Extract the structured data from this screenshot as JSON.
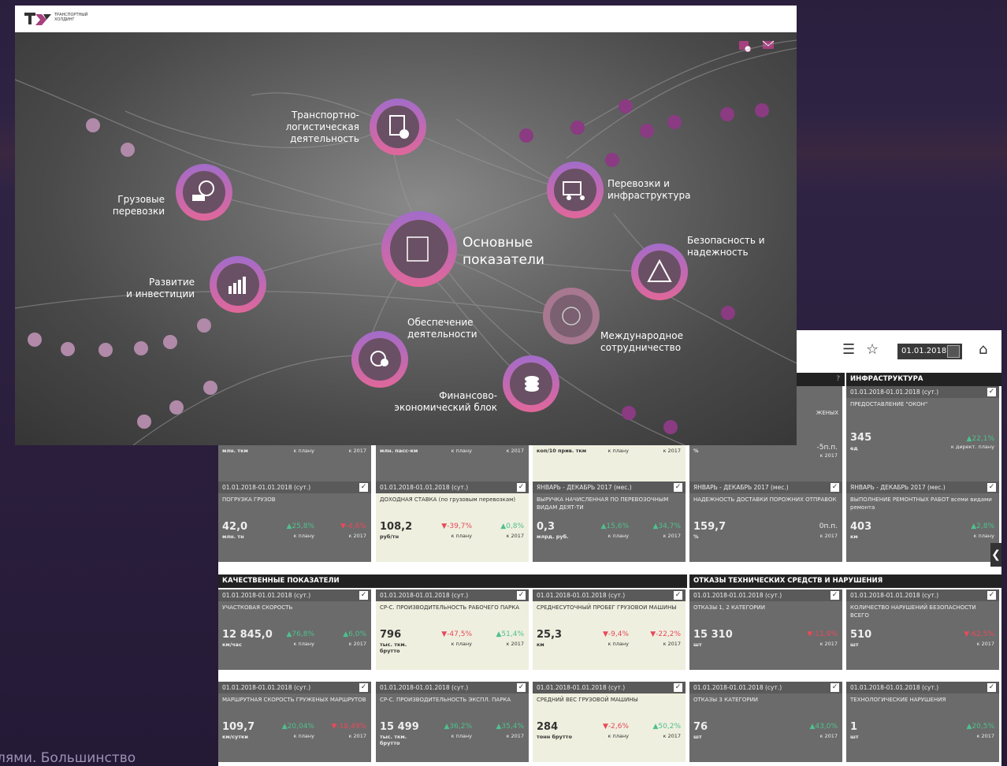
{
  "hero": {
    "logo_text": [
      "ТРАНСПОРТНЫЙ",
      "ХОЛДИНГ"
    ],
    "icons": [
      "calendar-icon",
      "mail-icon"
    ],
    "nodes": {
      "center": [
        "Основные",
        "показатели"
      ],
      "transport": [
        "Транспортно-логистическая",
        "деятельность"
      ],
      "cargo": [
        "Грузовые",
        "перевозки"
      ],
      "development": [
        "Развитие",
        "и инвестиции"
      ],
      "support": [
        "Обеспечение",
        "деятельности"
      ],
      "transport_infra": [
        "Перевозки и",
        "инфраструктура"
      ],
      "safety": [
        "Безопасность и",
        "надежность"
      ],
      "international": [
        "Международное",
        "сотрудничество"
      ],
      "finance": [
        "Финансово-",
        "экономический блок"
      ]
    }
  },
  "dashboard": {
    "date": "01.01.2018",
    "sections": {
      "infra": "ИНФРАСТРУКТУРА",
      "quality": "КАЧЕСТВЕННЫЕ ПОКАЗАТЕЛИ",
      "failures": "ОТКАЗЫ ТЕХНИЧЕСКИХ СРЕДСТВ И НАРУШЕНИЯ"
    },
    "top_row": {
      "c1": {
        "unit": "млн. ткм",
        "s1": "к плану",
        "s2": "к 2017"
      },
      "c2": {
        "unit": "млн. пасс-км",
        "s1": "к плану",
        "s2": "к 2017"
      },
      "c3": {
        "unit": "коп/10 прив. ткм",
        "s1": "к плану",
        "s2": "к 2017"
      },
      "c4": {
        "title_tail": "ЖЕНЫХ",
        "unit": "%",
        "d2": "-5п.п.",
        "s2": "к 2017"
      },
      "c5": {
        "period": "01.01.2018-01.01.2018 (сут.)",
        "title": "ПРЕДОСТАВЛЕНИЕ \"ОКОН\"",
        "value": "345",
        "unit": "ед",
        "d2": "▲22,1%",
        "s2": "к директ. плану"
      }
    },
    "row2": [
      {
        "period": "01.01.2018-01.01.2018 (сут.)",
        "title": "ПОГРУЗКА ГРУЗОВ",
        "value": "42,0",
        "unit": "млн. тн",
        "d1": "▲25,8%",
        "s1": "к плану",
        "d2": "▼-4,6%",
        "s2": "к 2017"
      },
      {
        "period": "01.01.2018-01.01.2018 (сут.)",
        "title": "ДОХОДНАЯ СТАВКА (по грузовым перевозкам)",
        "value": "108,2",
        "unit": "руб/тн",
        "d1": "▼-39,7%",
        "s1": "к плану",
        "d2": "▲0,8%",
        "s2": "к 2017"
      },
      {
        "period": "ЯНВАРЬ - ДЕКАБРЬ 2017 (мес.)",
        "title": "ВЫРУЧКА НАЧИСЛЕННАЯ ПО ПЕРЕВОЗОЧНЫМ ВИДАМ ДЕЯТ-ТИ",
        "value": "0,3",
        "unit": "млрд. руб.",
        "d1": "▲15,6%",
        "s1": "к плану",
        "d2": "▲34,7%",
        "s2": "к 2017"
      },
      {
        "period": "ЯНВАРЬ - ДЕКАБРЬ 2017 (мес.)",
        "title": "НАДЕЖНОСТЬ ДОСТАВКИ ПОРОЖНИХ ОТПРАВОК",
        "value": "159,7",
        "unit": "%",
        "d1": "",
        "s1": "",
        "d2": "0п.п.",
        "s2": "к 2017"
      },
      {
        "period": "ЯНВАРЬ - ДЕКАБРЬ 2017 (мес.)",
        "title": "ВЫПОЛНЕНИЕ РЕМОНТНЫХ РАБОТ всеми видами ремонта",
        "value": "403",
        "unit": "км",
        "d1": "",
        "s1": "",
        "d2": "▲2,8%",
        "s2": "к плану"
      }
    ],
    "row3": [
      {
        "period": "01.01.2018-01.01.2018 (сут.)",
        "title": "УЧАСТКОВАЯ СКОРОСТЬ",
        "value": "12 845,0",
        "unit": "км/час",
        "d1": "▲76,8%",
        "s1": "к плану",
        "d2": "▲6,0%",
        "s2": "к 2017"
      },
      {
        "period": "01.01.2018-01.01.2018 (сут.)",
        "title": "СР-С. ПРОИЗВОДИТЕЛЬНОСТЬ РАБОЧЕГО ПАРКА",
        "value": "796",
        "unit": "тыс. ткм. брутто",
        "d1": "▼-47,5%",
        "s1": "к плану",
        "d2": "▲51,4%",
        "s2": "к 2017"
      },
      {
        "period": "01.01.2018-01.01.2018 (сут.)",
        "title": "СРЕДНЕСУТОЧНЫЙ ПРОБЕГ ГРУЗОВОИ МАШИНЫ",
        "value": "25,3",
        "unit": "км",
        "d1": "▼-9,4%",
        "s1": "к плану",
        "d2": "▼-22,2%",
        "s2": "к 2017"
      },
      {
        "period": "01.01.2018-01.01.2018 (сут.)",
        "title": "ОТКАЗЫ 1, 2 КАТЕГОРИИ",
        "value": "15 310",
        "unit": "шт",
        "d1": "",
        "s1": "",
        "d2": "▼-11,9%",
        "s2": "к 2017"
      },
      {
        "period": "01.01.2018-01.01.2018 (сут.)",
        "title": "КОЛИЧЕСТВО НАРУШЕНИЙ БЕЗОПАСНОСТИ ВСЕГО",
        "value": "510",
        "unit": "шт",
        "d1": "",
        "s1": "",
        "d2": "▼-62,5%",
        "s2": "к 2017"
      }
    ],
    "row4": [
      {
        "period": "01.01.2018-01.01.2018 (сут.)",
        "title": "МАРШРУТНАЯ СКОРОСТЬ ГРУЖЕНЫХ МАРШРУТОВ",
        "value": "109,7",
        "unit": "км/сутки",
        "d1": "▲20,04%",
        "s1": "к плану",
        "d2": "▼-18,49%",
        "s2": "к 2017"
      },
      {
        "period": "01.01.2018-01.01.2018 (сут.)",
        "title": "СР-С. ПРОИЗВОДИТЕЛЬНОСТЬ ЭКСПЛ. ПАРКА",
        "value": "15 499",
        "unit": "тыс. ткм. брутто",
        "d1": "▲36,2%",
        "s1": "к плану",
        "d2": "▲35,4%",
        "s2": "к 2017"
      },
      {
        "period": "01.01.2018-01.01.2018 (сут.)",
        "title": "СРЕДНИЙ ВЕС ГРУЗОВОЙ МАШИНЫ",
        "value": "284",
        "unit": "тонн брутто",
        "d1": "▼-2,6%",
        "s1": "к плану",
        "d2": "▲50,2%",
        "s2": "к 2017"
      },
      {
        "period": "01.01.2018-01.01.2018 (сут.)",
        "title": "ОТКАЗЫ 3 КАТЕГОРИИ",
        "value": "76",
        "unit": "шт",
        "d1": "",
        "s1": "",
        "d2": "▲43,0%",
        "s2": "к 2017"
      },
      {
        "period": "01.01.2018-01.01.2018 (сут.)",
        "title": "ТЕХНОЛОГИЧЕСКИЕ НАРУШЕНИЯ",
        "value": "1",
        "unit": "шт",
        "d1": "",
        "s1": "",
        "d2": "▲20,5%",
        "s2": "к 2017"
      }
    ]
  },
  "caption": "лями. Большинство"
}
